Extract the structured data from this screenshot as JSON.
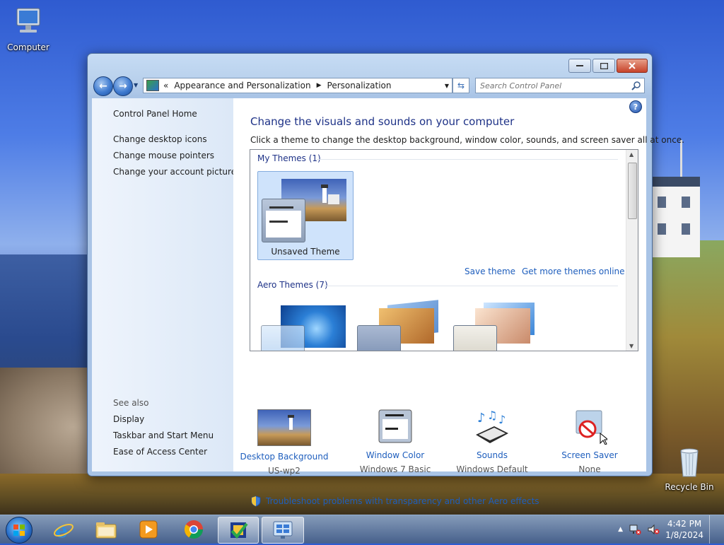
{
  "desktop": {
    "icons": [
      {
        "label": "Computer"
      },
      {
        "label": "Recycle Bin"
      }
    ]
  },
  "window": {
    "breadcrumb": {
      "parent": "Appearance and Personalization",
      "current": "Personalization",
      "chevrons": "«"
    },
    "search_placeholder": "Search Control Panel",
    "left_pane": {
      "home": "Control Panel Home",
      "links": [
        "Change desktop icons",
        "Change mouse pointers",
        "Change your account picture"
      ],
      "see_also_title": "See also",
      "see_also": [
        "Display",
        "Taskbar and Start Menu",
        "Ease of Access Center"
      ]
    },
    "main": {
      "heading": "Change the visuals and sounds on your computer",
      "subheading": "Click a theme to change the desktop background, window color, sounds, and screen saver all at once.",
      "my_themes_title": "My Themes (1)",
      "unsaved_theme_label": "Unsaved Theme",
      "save_theme": "Save theme",
      "get_more": "Get more themes online",
      "aero_themes_title": "Aero Themes (7)",
      "bottom_items": [
        {
          "label": "Desktop Background",
          "value": "US-wp2",
          "icon": "desktop-background-icon"
        },
        {
          "label": "Window Color",
          "value": "Windows 7 Basic",
          "icon": "window-color-icon"
        },
        {
          "label": "Sounds",
          "value": "Windows Default",
          "icon": "sounds-icon"
        },
        {
          "label": "Screen Saver",
          "value": "None",
          "icon": "screen-saver-icon"
        }
      ],
      "troubleshoot": "Troubleshoot problems with transparency and other Aero effects"
    }
  },
  "taskbar": {
    "clock_time": "4:42 PM",
    "clock_date": "1/8/2024"
  },
  "colors": {
    "link": "#1e5ebd",
    "heading": "#1e3287",
    "selected_tile": "#cfe3fb"
  }
}
